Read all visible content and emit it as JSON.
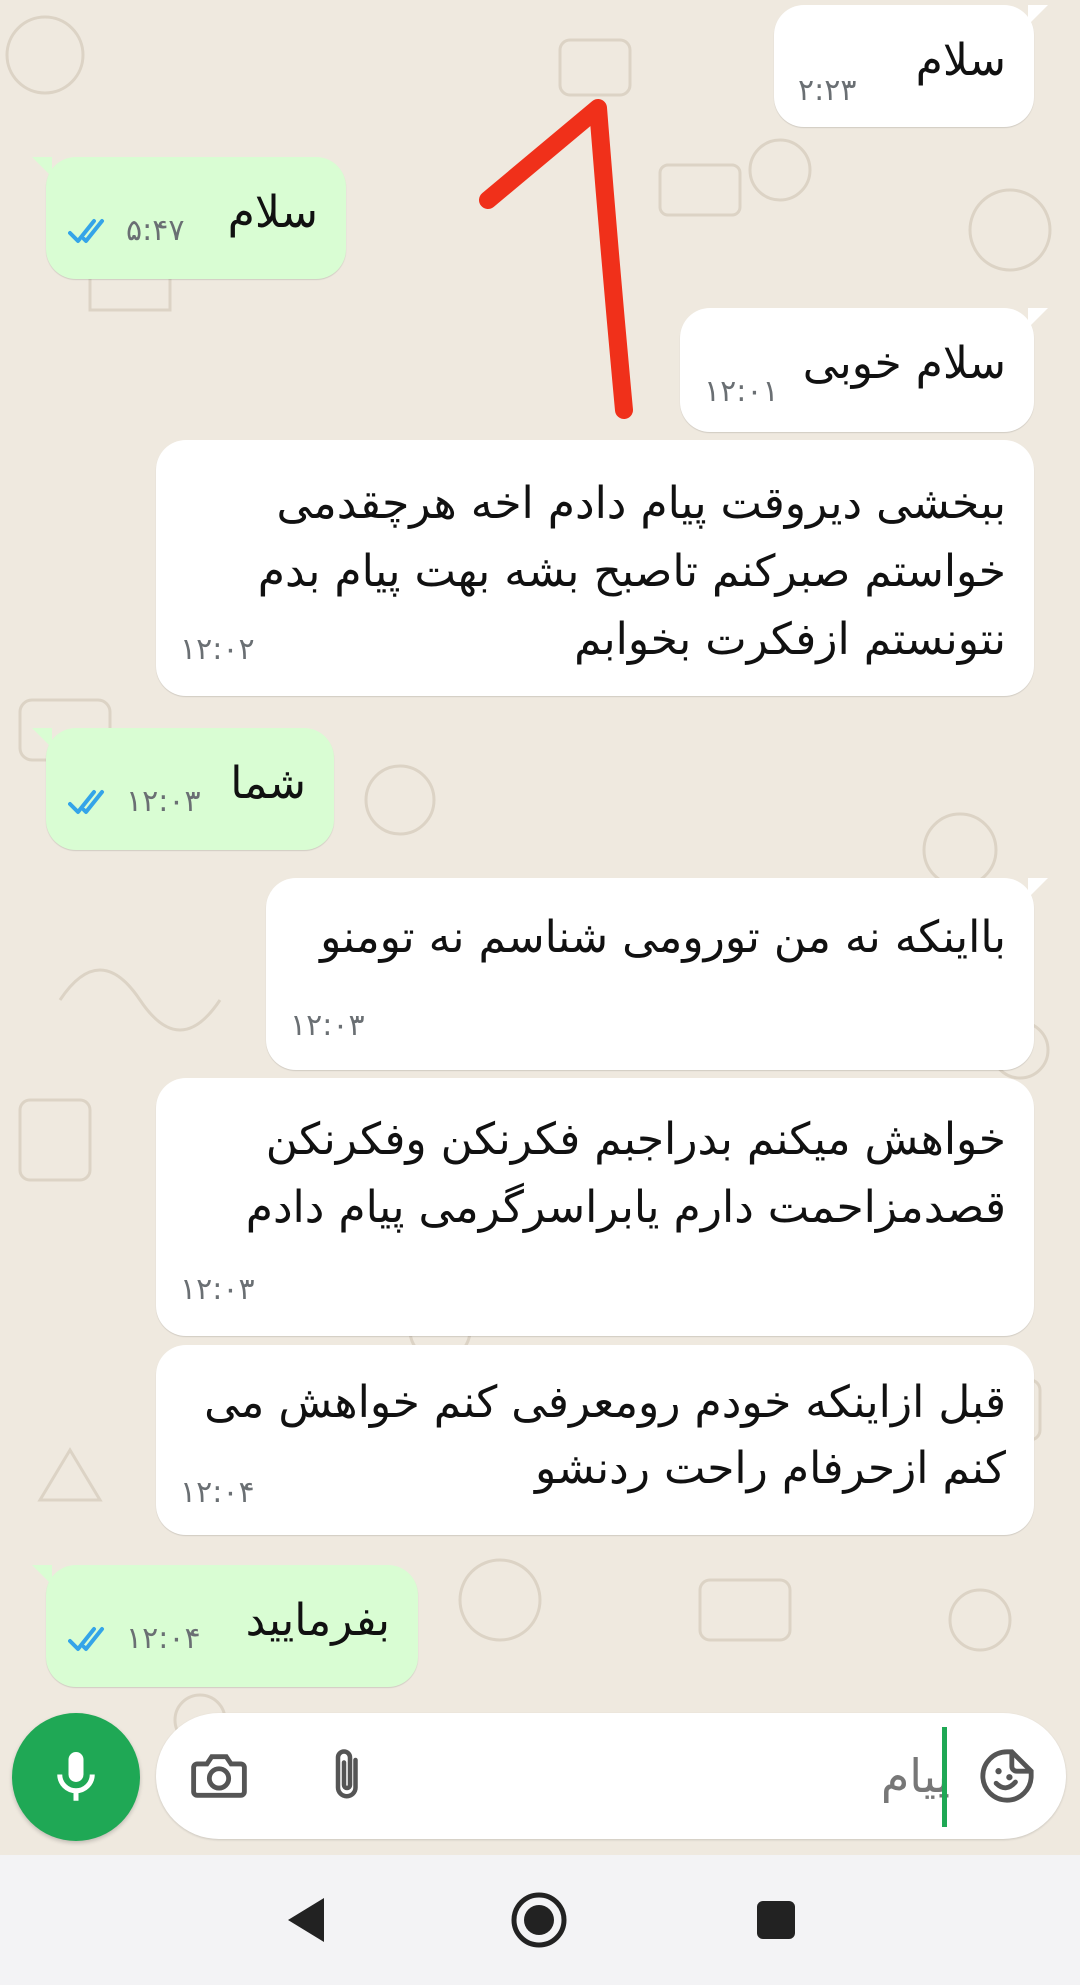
{
  "chat": {
    "messages": [
      {
        "direction": "incoming",
        "lines": [
          "سلام"
        ],
        "time": "۲:۲۳"
      },
      {
        "direction": "outgoing",
        "lines": [
          "سلام"
        ],
        "time": "۵:۴۷",
        "status": "read"
      },
      {
        "direction": "incoming",
        "lines": [
          "سلام خوبی"
        ],
        "time": "۱۲:۰۱"
      },
      {
        "direction": "incoming",
        "lines": [
          "ببخشی دیروقت پیام دادم اخه هرچقدمی",
          "خواستم صبرکنم تاصبح بشه بهت پیام بدم",
          "نتونستم ازفکرت بخوابم"
        ],
        "time": "۱۲:۰۲"
      },
      {
        "direction": "outgoing",
        "lines": [
          "شما"
        ],
        "time": "۱۲:۰۳",
        "status": "read"
      },
      {
        "direction": "incoming",
        "lines": [
          "بااینکه نه من تورومی شناسم نه  تومنو"
        ],
        "time": "۱۲:۰۳"
      },
      {
        "direction": "incoming",
        "lines": [
          "خواهش میکنم بدراجبم فکرنکن وفکرنکن",
          "قصدمزاحمت دارم یابراسرگرمی پیام دادم"
        ],
        "time": "۱۲:۰۳"
      },
      {
        "direction": "incoming",
        "lines": [
          "قبل ازاینکه خودم رومعرفی کنم خواهش می",
          "کنم ازحرفام راحت ردنشو"
        ],
        "time": "۱۲:۰۴"
      },
      {
        "direction": "outgoing",
        "lines": [
          "بفرمایید"
        ],
        "time": "۱۲:۰۴",
        "status": "read"
      }
    ],
    "annotation": {
      "label": "1",
      "color": "#f0301a"
    }
  },
  "composer": {
    "value": "پیام",
    "emoji_icon": "sticker-icon",
    "attach_icon": "paperclip-icon",
    "camera_icon": "camera-icon",
    "mic_icon": "microphone-icon",
    "accent": "#1fa855"
  },
  "navigation": {
    "back_icon": "back-triangle-icon",
    "home_icon": "home-circle-icon",
    "recents_icon": "recents-square-icon"
  },
  "colors": {
    "incoming_bubble": "#ffffff",
    "outgoing_bubble": "#d9fdd3",
    "read_ticks": "#34a4e8",
    "wallpaper": "#efe9df"
  }
}
